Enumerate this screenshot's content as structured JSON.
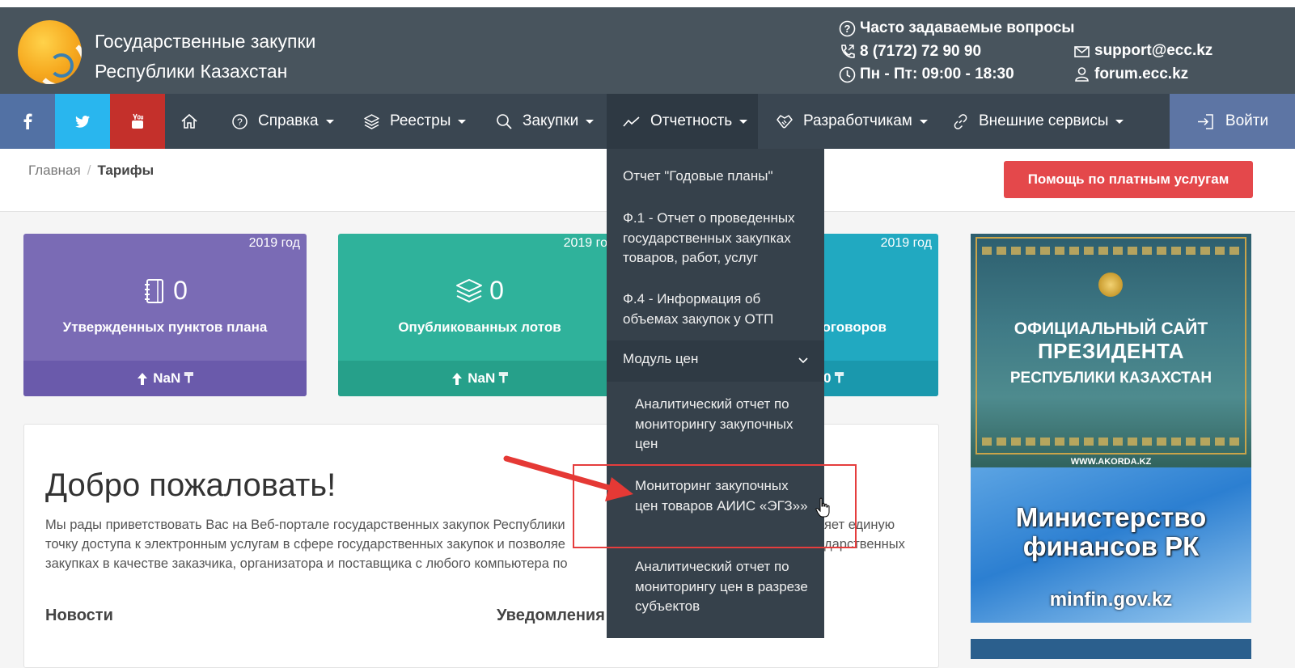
{
  "header": {
    "title_line1": "Государственные закупки",
    "title_line2": "Республики Казахстан",
    "faq": "Часто задаваемые вопросы",
    "phone": "8 (7172) 72 90 90",
    "hours": "Пн - Пт: 09:00 - 18:30",
    "email": "support@ecc.kz",
    "forum": "forum.ecc.kz"
  },
  "nav": {
    "social": [
      "facebook-icon",
      "twitter-icon",
      "youtube-icon"
    ],
    "items": [
      "Справка",
      "Реестры",
      "Закупки",
      "Отчетность",
      "Разработчикам",
      "Внешние сервисы"
    ],
    "login": "Войти"
  },
  "breadcrumb": {
    "home": "Главная",
    "separator": "/",
    "current": "Тарифы"
  },
  "help_button": "Помощь по платным услугам",
  "cards": [
    {
      "year": "2019 год",
      "value": "0",
      "label": "Утвержденных пунктов плана",
      "foot": "NaN ₸",
      "color": "#7a6bb5"
    },
    {
      "year": "2019 год",
      "value": "0",
      "label": "Опубликованных лотов",
      "foot": "NaN ₸",
      "color": "#2fb29b"
    },
    {
      "year": "2019 год",
      "label": "оговоров",
      "foot": "0 ₸",
      "color": "#21a9c1"
    }
  ],
  "welcome": {
    "title": "Добро пожаловать!",
    "line1a": "Мы рады приветствовать Вас на Веб-портале государственных закупок Республики",
    "line1b": "яет единую",
    "line2a": "точку доступа к электронным услугам в сфере государственных закупок и позволяе",
    "line2b": "дарственных",
    "line3": "закупках в качестве заказчика, организатора и поставщика с любого компьютера по",
    "news": "Новости",
    "notifications": "Уведомления"
  },
  "dropdown": {
    "items": [
      "Отчет \"Годовые планы\"",
      "Ф.1 - Отчет о проведенных государственных закупках товаров, работ, услуг",
      "Ф.4 - Информация об объемах закупок у ОТП"
    ],
    "group": "Модуль цен",
    "sub_items": [
      "Аналитический отчет по мониторингу закупочных цен",
      "Мониторинг закупочных цен товаров АИИС «ЭГЗ»»",
      "Аналитический отчет по мониторингу цен в разрезе субъектов"
    ]
  },
  "banners": {
    "b1_line1": "ОФИЦИАЛЬНЫЙ САЙТ",
    "b1_line2": "ПРЕЗИДЕНТА",
    "b1_line3": "РЕСПУБЛИКИ КАЗАХСТАН",
    "b1_url": "WWW.AKORDA.KZ",
    "b2_line1": "Министерство",
    "b2_line2": "финансов РК",
    "b2_url": "minfin.gov.kz"
  },
  "colors": {
    "header": "#48545d",
    "nav": "#3a4651",
    "accent_red": "#e4484b",
    "login": "#5d75a4"
  }
}
